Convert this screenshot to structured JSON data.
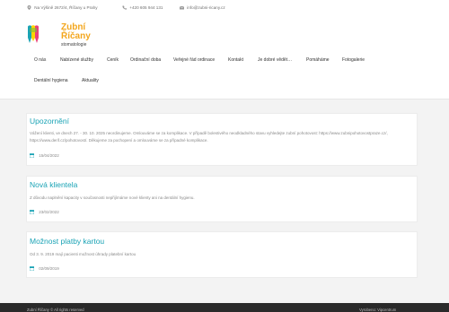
{
  "topbar": {
    "address": "Na Výšině 2672/4, Říčany u Prahy",
    "phone": "+420 605 944 131",
    "email": "info@zubni-ricany.cz"
  },
  "logo": {
    "line1": "Zubní",
    "line2": "Říčany",
    "line3": "stomatologie",
    "colors": {
      "orange": "#f3a61c",
      "teal": "#1aa3b5",
      "pink": "#e9407a",
      "green": "#7bbf3a",
      "yellow": "#ffd400"
    }
  },
  "nav": {
    "items": [
      "O nás",
      "Nabízené služby",
      "Ceník",
      "Ordinační doba",
      "Veřejné řád ordinace",
      "Kontakt",
      "Je dobré vědět…",
      "Pomáháme",
      "Fotogalerie",
      "Dentální hygiena",
      "Aktuality"
    ]
  },
  "posts": [
    {
      "title": "Upozornění",
      "text": "Vážení klienti, ve dnech 27. - 30. 10. 2025 neordinujeme. Omlouváme se za komplikace. V případě bolestivého neodkladného stavu vyhledejte zubní pohotovost: https://www.zubnipohotovostpraze.cz/, https://www.derif.cz/pohotovost/. Děkujeme za pochopení a omlouváme se za případné komplikace.",
      "date": "15/04/2022"
    },
    {
      "title": "Nová klientela",
      "text": "Z důvodu naplnění kapacity v současnosti nepřijímáme nové klienty ani na dentální hygienu.",
      "date": "23/02/2022"
    },
    {
      "title": "Možnost platby kartou",
      "text": "Od 3. 9. 2019 mají pacienti možnost úhrady platební kartou",
      "date": "02/09/2019"
    }
  ],
  "footer": {
    "left": "Zubní Říčany © All rights reserved",
    "right": "Vyrobeno: Vipcentrum"
  }
}
